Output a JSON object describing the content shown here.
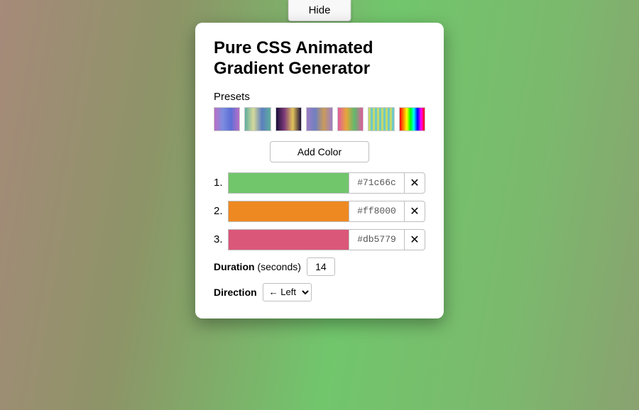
{
  "hide_label": "Hide",
  "title": "Pure CSS Animated Gradient Generator",
  "presets_label": "Presets",
  "add_color_label": "Add Color",
  "colors": [
    {
      "num": "1.",
      "hex": "#71c66c",
      "swatch": "#71c66c"
    },
    {
      "num": "2.",
      "hex": "#ff8000",
      "swatch": "#ee8922"
    },
    {
      "num": "3.",
      "hex": "#db5779",
      "swatch": "#db5779"
    }
  ],
  "duration_label_bold": "Duration",
  "duration_label_rest": " (seconds)",
  "duration_value": "14",
  "direction_label": "Direction",
  "direction_value": "← Left"
}
